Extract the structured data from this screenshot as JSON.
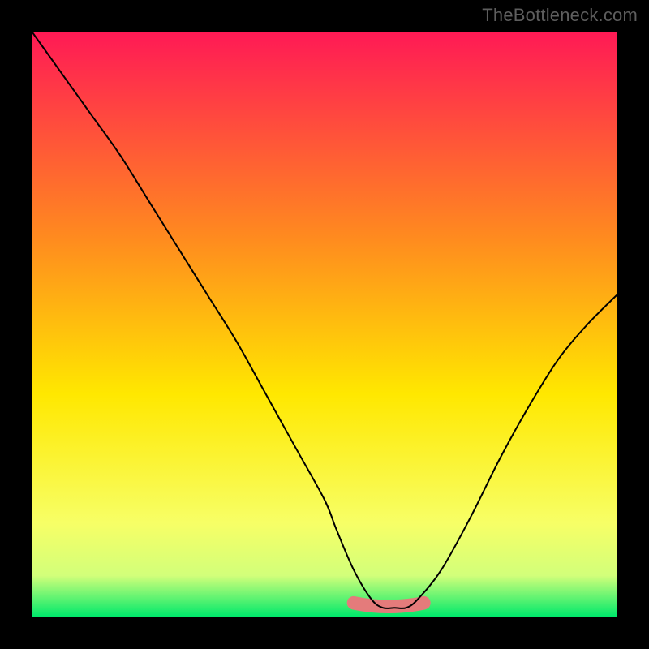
{
  "watermark": "TheBottleneck.com",
  "chart_data": {
    "type": "line",
    "title": "",
    "xlabel": "",
    "ylabel": "",
    "xlim": [
      0,
      100
    ],
    "ylim": [
      0,
      100
    ],
    "grid": false,
    "legend": false,
    "background_gradient": {
      "top_color": "#ff1a55",
      "mid_color": "#ffe800",
      "bottom_color": "#00e96b"
    },
    "series": [
      {
        "name": "bottleneck-curve",
        "color": "#000000",
        "x": [
          0,
          5,
          10,
          15,
          20,
          25,
          30,
          35,
          40,
          45,
          50,
          52,
          55,
          58,
          60,
          62,
          64,
          66,
          70,
          75,
          80,
          85,
          90,
          95,
          100
        ],
        "y": [
          100,
          93,
          86,
          79,
          71,
          63,
          55,
          47,
          38,
          29,
          20,
          15,
          8,
          3,
          1.5,
          1.5,
          1.5,
          3,
          8,
          17,
          27,
          36,
          44,
          50,
          55
        ]
      }
    ],
    "highlight_band": {
      "name": "optimal-zone",
      "color": "#e47b7b",
      "x_center": 61,
      "x_halfwidth": 6,
      "y_level": 1.5,
      "thickness_pct": 2.3
    }
  }
}
